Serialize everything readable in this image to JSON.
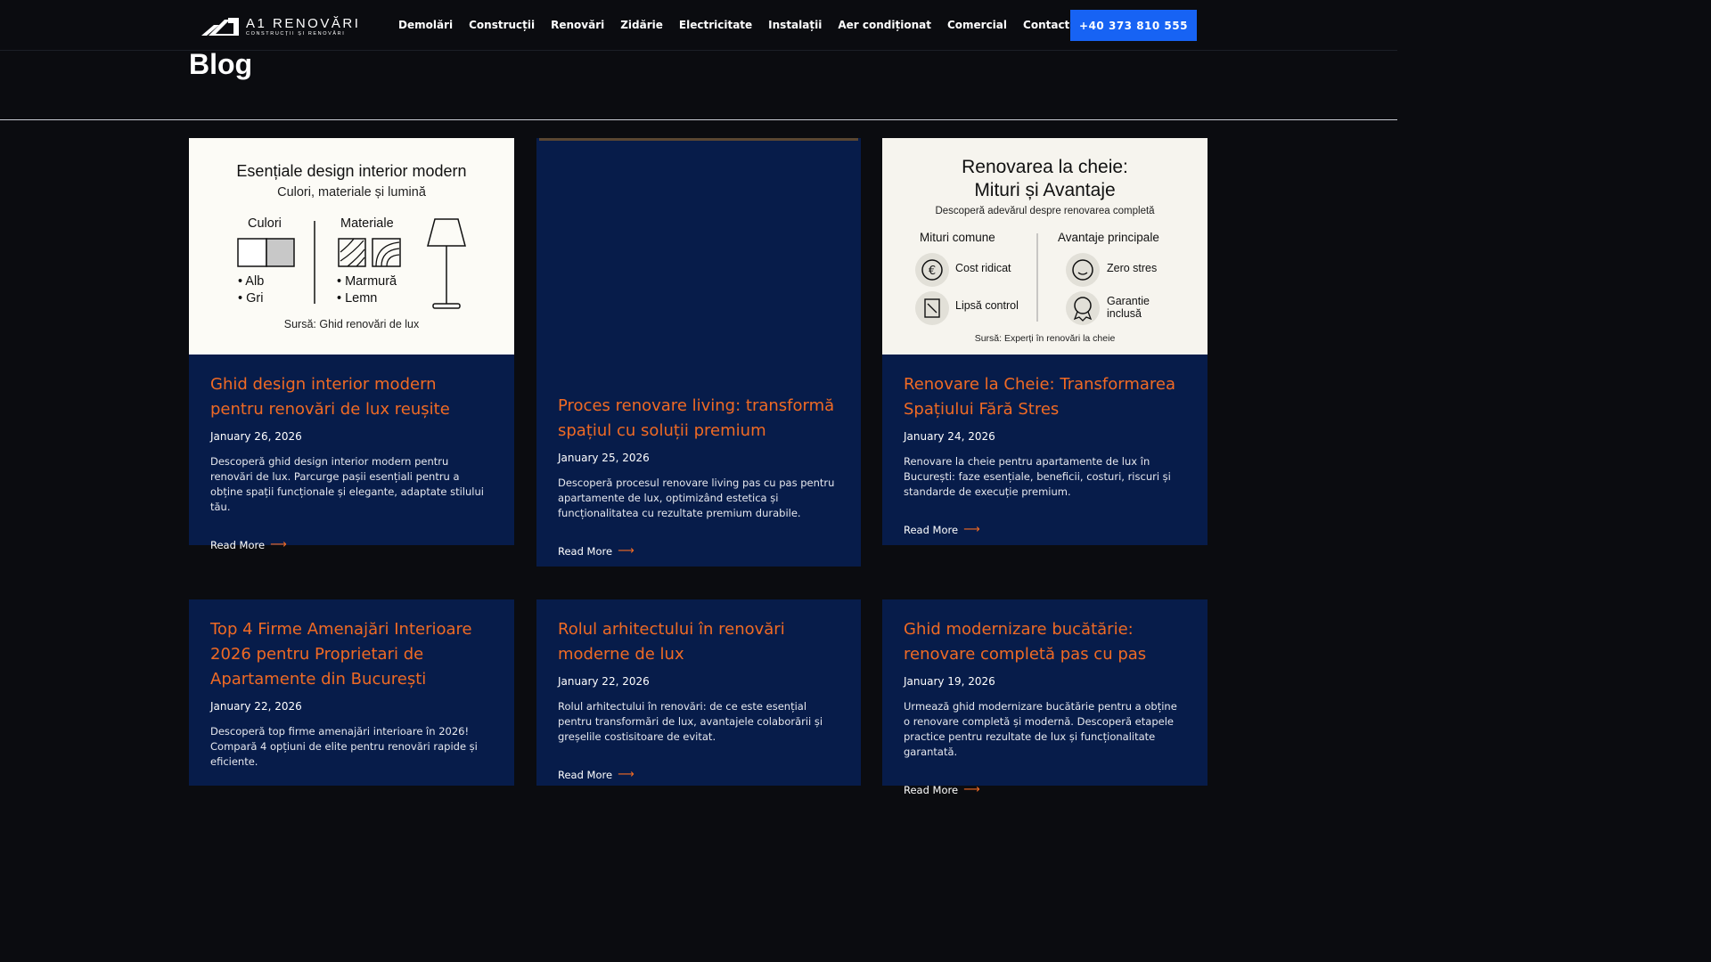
{
  "header": {
    "logo_name": "A1 RENOVĂRI",
    "logo_sub": "CONSTRUCȚII ȘI RENOVĂRI",
    "nav": [
      "Demolări",
      "Construcții",
      "Renovări",
      "Zidărie",
      "Electricitate",
      "Instalații",
      "Aer condiționat",
      "Comercial",
      "Contact"
    ],
    "phone": "+40 373 810 555",
    "accent": "#1763f4"
  },
  "page": {
    "title": "Blog"
  },
  "colors": {
    "card_bg": "#071c4a",
    "title": "#f06a24",
    "page_bg": "#0b0c10"
  },
  "cards": [
    {
      "title": "Ghid design interior modern pentru renovări de lux reușite",
      "date": "January 26, 2026",
      "excerpt": "Descoperă ghid design interior modern pentru renovări de lux. Parcurge pașii esențiali pentru a obține spații funcționale și elegante, adaptate stilului tău.",
      "read_more": "Read More",
      "image": {
        "heading": "Esențiale design interior modern",
        "sub": "Culori, materiale și lumină",
        "col1": "Culori",
        "col2": "Materiale",
        "col1_items": [
          "• Alb",
          "• Gri"
        ],
        "col2_items": [
          "• Marmură",
          "• Lemn"
        ],
        "source": "Sursă: Ghid renovări de lux"
      }
    },
    {
      "title": "Proces renovare living: transformă spațiul cu soluții premium",
      "date": "January 25, 2026",
      "excerpt": "Descoperă procesul renovare living pas cu pas pentru apartamente de lux, optimizând estetica și funcționalitatea cu rezultate premium durabile.",
      "read_more": "Read More"
    },
    {
      "title": "Renovare la Cheie: Transformarea Spațiului Fără Stres",
      "date": "January 24, 2026",
      "excerpt": "Renovare la cheie pentru apartamente de lux în București: faze esențiale, beneficii, costuri, riscuri și standarde de execuție premium.",
      "read_more": "Read More",
      "image": {
        "heading1": "Renovarea la cheie:",
        "heading2": "Mituri și Avantaje",
        "sub": "Descoperă adevărul despre renovarea completă",
        "col1": "Mituri comune",
        "col2": "Avantaje principale",
        "myth1": "Cost ridicat",
        "myth2": "Lipsă control",
        "adv1": "Zero stres",
        "adv2a": "Garantie",
        "adv2b": "inclusă",
        "source": "Sursă: Experți în renovări la cheie"
      }
    },
    {
      "title": "Top 4 Firme Amenajări Interioare 2026 pentru Proprietari de Apartamente din București",
      "date": "January 22, 2026",
      "excerpt": "Descoperă top firme amenajări interioare în 2026! Compară 4 opțiuni de elite pentru renovări rapide și eficiente.",
      "read_more": "Read More"
    },
    {
      "title": "Rolul arhitectului în renovări moderne de lux",
      "date": "January 22, 2026",
      "excerpt": "Rolul arhitectului în renovări: de ce este esențial pentru transformări de lux, avantajele colaborării și greșelile costisitoare de evitat.",
      "read_more": "Read More"
    },
    {
      "title": "Ghid modernizare bucătărie: renovare completă pas cu pas",
      "date": "January 19, 2026",
      "excerpt": "Urmează ghid modernizare bucătărie pentru a obține o renovare completă și modernă. Descoperă etapele practice pentru rezultate de lux și funcționalitate garantată.",
      "read_more": "Read More"
    }
  ]
}
